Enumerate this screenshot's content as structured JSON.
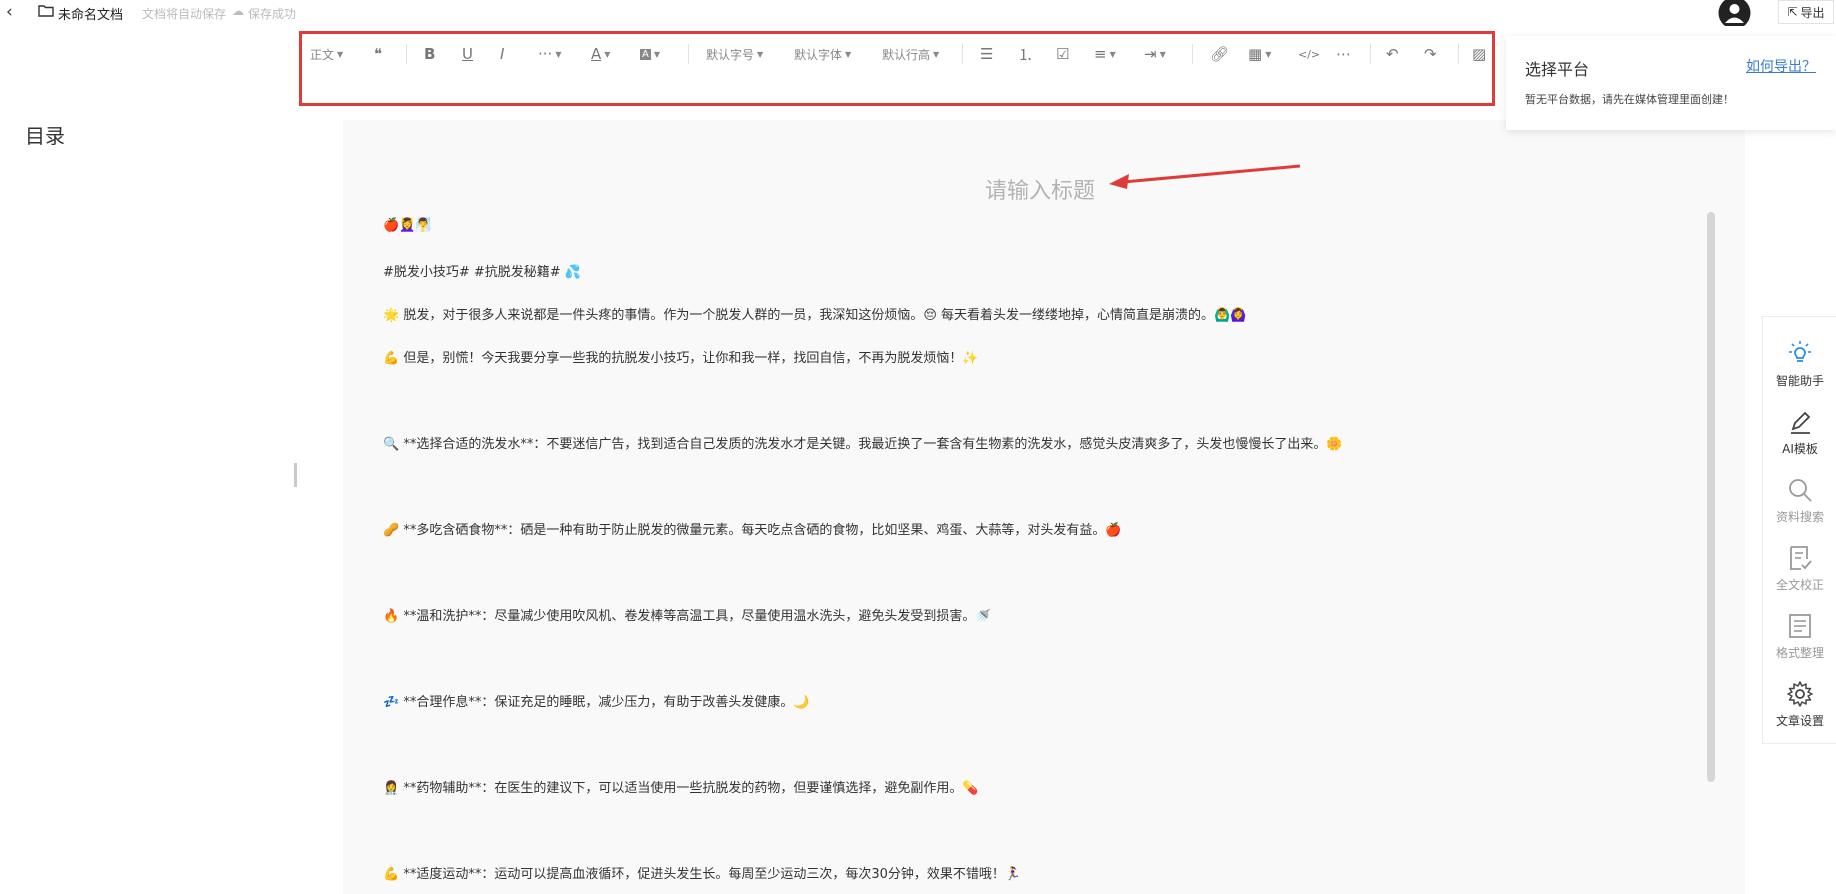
{
  "header": {
    "back_icon": "chevron-left-icon",
    "doc_title": "未命名文档",
    "autosave_text": "文档将自动保存",
    "saved_text": "保存成功",
    "export_label": "导出"
  },
  "toolbar": {
    "paragraph_style": "正文",
    "font_size": "默认字号",
    "font_family": "默认字体",
    "line_height": "默认行高",
    "highlight_color": "#e03b3b"
  },
  "sidebar": {
    "toc_title": "目录"
  },
  "editor": {
    "title_placeholder": "请输入标题",
    "lines": [
      "🍎💆‍♀️🧖‍♂️",
      "#脱发小技巧# #抗脱发秘籍# 💦",
      "🌟 脱发，对于很多人来说都是一件头疼的事情。作为一个脱发人群的一员，我深知这份烦恼。😔 每天看着头发一缕缕地掉，心情简直是崩溃的。🙆‍♂️🙆‍♀️",
      "💪 但是，别慌！今天我要分享一些我的抗脱发小技巧，让你和我一样，找回自信，不再为脱发烦恼！✨",
      "🔍 **选择合适的洗发水**：不要迷信广告，找到适合自己发质的洗发水才是关键。我最近换了一套含有生物素的洗发水，感觉头皮清爽多了，头发也慢慢长了出来。🌼",
      "🥜 **多吃含硒食物**：硒是一种有助于防止脱发的微量元素。每天吃点含硒的食物，比如坚果、鸡蛋、大蒜等，对头发有益。🍎",
      "🔥 **温和洗护**：尽量减少使用吹风机、卷发棒等高温工具，尽量使用温水洗头，避免头发受到损害。🚿",
      "💤 **合理作息**：保证充足的睡眠，减少压力，有助于改善头发健康。🌙",
      "👩‍⚕️ **药物辅助**：在医生的建议下，可以适当使用一些抗脱发的药物，但要谨慎选择，避免副作用。💊",
      "💪 **适度运动**：运动可以提高血液循环，促进头发生长。每周至少运动三次，每次30分钟，效果不错哦！🏃‍♀️"
    ]
  },
  "export_panel": {
    "title": "选择平台",
    "help_link": "如何导出？",
    "message": "暂无平台数据，请先在媒体管理里面创建！"
  },
  "right_tools": [
    {
      "label": "智能助手",
      "icon": "lightbulb-icon",
      "color": "#2a8fe0",
      "label_color": "#333"
    },
    {
      "label": "AI模板",
      "icon": "pen-icon",
      "color": "#444",
      "label_color": "#333"
    },
    {
      "label": "资料搜索",
      "icon": "search-icon",
      "color": "#999",
      "label_color": "#999"
    },
    {
      "label": "全文校正",
      "icon": "check-doc-icon",
      "color": "#999",
      "label_color": "#999"
    },
    {
      "label": "格式整理",
      "icon": "format-icon",
      "color": "#999",
      "label_color": "#999"
    },
    {
      "label": "文章设置",
      "icon": "gear-icon",
      "color": "#444",
      "label_color": "#333"
    }
  ]
}
